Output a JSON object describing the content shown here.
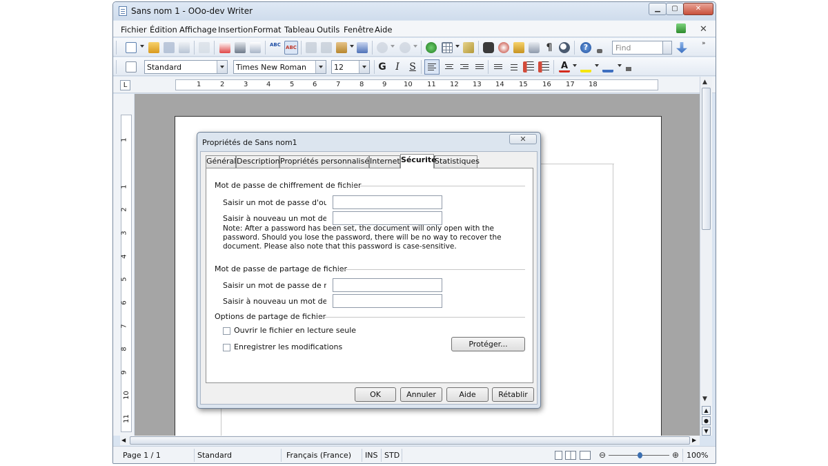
{
  "window": {
    "title": "Sans nom 1 - OOo-dev Writer",
    "minimize": "▁",
    "maximize": "▢",
    "close": "✕"
  },
  "menubar": {
    "items": [
      "Fichier",
      "Édition",
      "Affichage",
      "Insertion",
      "Format",
      "Tableau",
      "Outils",
      "Fenêtre",
      "Aide"
    ],
    "close": "✕"
  },
  "toolbar": {
    "find_placeholder": "Find",
    "paragraph_style": "Standard",
    "font_name": "Times New Roman",
    "font_size": "12",
    "bold": "G",
    "italic": "I",
    "underline": "S"
  },
  "ruler": {
    "tab_type": "L",
    "h_numbers": [
      "1",
      "2",
      "3",
      "4",
      "5",
      "6",
      "7",
      "8",
      "9",
      "10",
      "11",
      "12",
      "13",
      "14",
      "15",
      "16",
      "17",
      "18"
    ],
    "v_numbers": [
      "1",
      "1",
      "2",
      "3",
      "4",
      "5",
      "6",
      "7",
      "8",
      "9",
      "10",
      "11"
    ]
  },
  "statusbar": {
    "page": "Page 1 / 1",
    "style": "Standard",
    "language": "Français (France)",
    "insert_mode": "INS",
    "selection_mode": "STD",
    "zoom": "100%"
  },
  "dialog": {
    "title": "Propriétés de Sans nom1",
    "close": "✕",
    "tabs": [
      "Général",
      "Description",
      "Propriétés personnalisées",
      "Internet",
      "Sécurité",
      "Statistiques"
    ],
    "active_tab": "Sécurité",
    "section_encryption": "Mot de passe de chiffrement de fichier",
    "enter_open_password": "Saisir un mot de passe d'ouvertu",
    "reenter_open_password": "Saisir à nouveau un mot de pass",
    "note": "Note: After a password has been set, the document will only open with the password. Should you lose the password, there will be no way to recover the document. Please also note that this password is case-sensitive.",
    "section_sharing": "Mot de passe de partage de fichier",
    "enter_modify_password": "Saisir un mot de passe de modif",
    "reenter_modify_password": "Saisir à nouveau un mot de pass",
    "section_options": "Options de partage de fichier",
    "readonly_label": "Ouvrir le fichier en lecture seule",
    "record_changes_label": "Enregistrer les modifications",
    "protect_button": "Protéger...",
    "ok": "OK",
    "cancel": "Annuler",
    "help": "Aide",
    "reset": "Rétablir"
  }
}
